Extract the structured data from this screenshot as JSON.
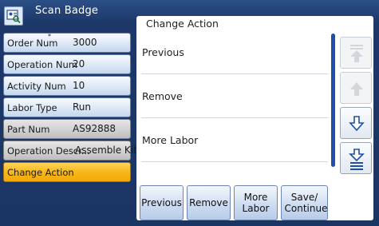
{
  "window": {
    "title": "Scan Badge",
    "icon": "badge-scan-icon"
  },
  "fields": [
    {
      "label": "Order Num",
      "required_mark": "*",
      "value": "3000",
      "state": "editable"
    },
    {
      "label": "Operation Num",
      "value": "20",
      "state": "editable"
    },
    {
      "label": "Activity Num",
      "value": "10",
      "state": "editable"
    },
    {
      "label": "Labor Type",
      "value": "Run",
      "state": "editable"
    },
    {
      "label": "Part Num",
      "value": "AS92888",
      "state": "disabled"
    },
    {
      "label": "Operation Descr...",
      "value": "Assemble Kit",
      "state": "disabled"
    },
    {
      "label": "Change Action",
      "value": "",
      "state": "active"
    }
  ],
  "panel": {
    "title": "Change Action",
    "options": [
      "Previous",
      "Remove",
      "More Labor"
    ],
    "scroll_buttons": [
      {
        "icon": "scroll-top-icon",
        "enabled": false
      },
      {
        "icon": "scroll-up-icon",
        "enabled": false
      },
      {
        "icon": "scroll-down-icon",
        "enabled": true
      },
      {
        "icon": "scroll-bottom-icon",
        "enabled": true
      }
    ],
    "actions": [
      "Previous",
      "Remove",
      "More Labor",
      "Save/ Continue"
    ]
  },
  "colors": {
    "accent_active": "#f6b515",
    "scrollbar": "#1f4fa8",
    "header": "#1c3768"
  }
}
